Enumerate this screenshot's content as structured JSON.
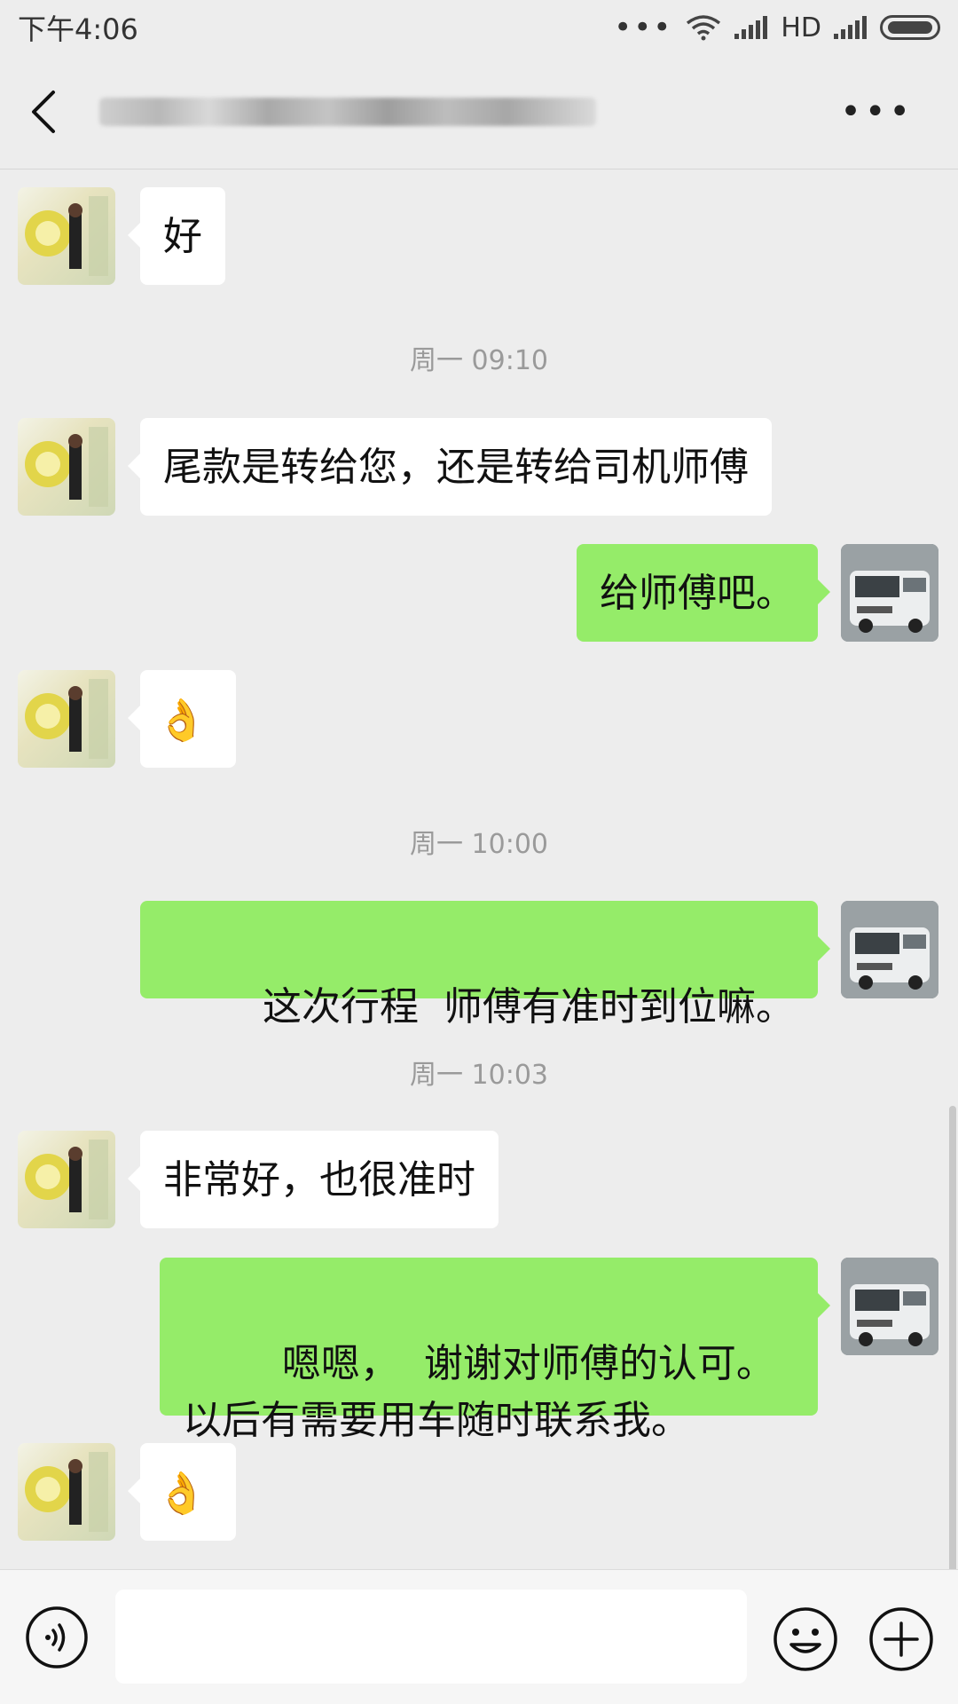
{
  "status_bar": {
    "time": "下午4:06",
    "dots": "•••",
    "network": "HD"
  },
  "header": {
    "title": ""
  },
  "messages": [
    {
      "side": "in",
      "text": "好"
    },
    {
      "type": "time",
      "text": "周一 09:10"
    },
    {
      "side": "in",
      "text": "尾款是转给您，还是转给司机师傅"
    },
    {
      "side": "out",
      "text": "给师傅吧。"
    },
    {
      "side": "in",
      "emoji": "👌"
    },
    {
      "type": "time",
      "text": "周一 10:00"
    },
    {
      "side": "out",
      "text": "这次行程  师傅有准时到位嘛。"
    },
    {
      "type": "time",
      "text": "周一 10:03"
    },
    {
      "side": "in",
      "text": "非常好，也很准时"
    },
    {
      "side": "out",
      "text": "嗯嗯，  谢谢对师傅的认可。以后有需要用车随时联系我。"
    },
    {
      "side": "in",
      "emoji": "👌"
    }
  ],
  "input": {
    "placeholder": ""
  },
  "colors": {
    "background": "#ededed",
    "outgoing": "#95ec69",
    "incoming": "#ffffff",
    "timestamp": "#9a9a9a"
  },
  "icons": [
    "back-icon",
    "more-icon",
    "voice-icon",
    "emoji-icon",
    "plus-icon"
  ]
}
